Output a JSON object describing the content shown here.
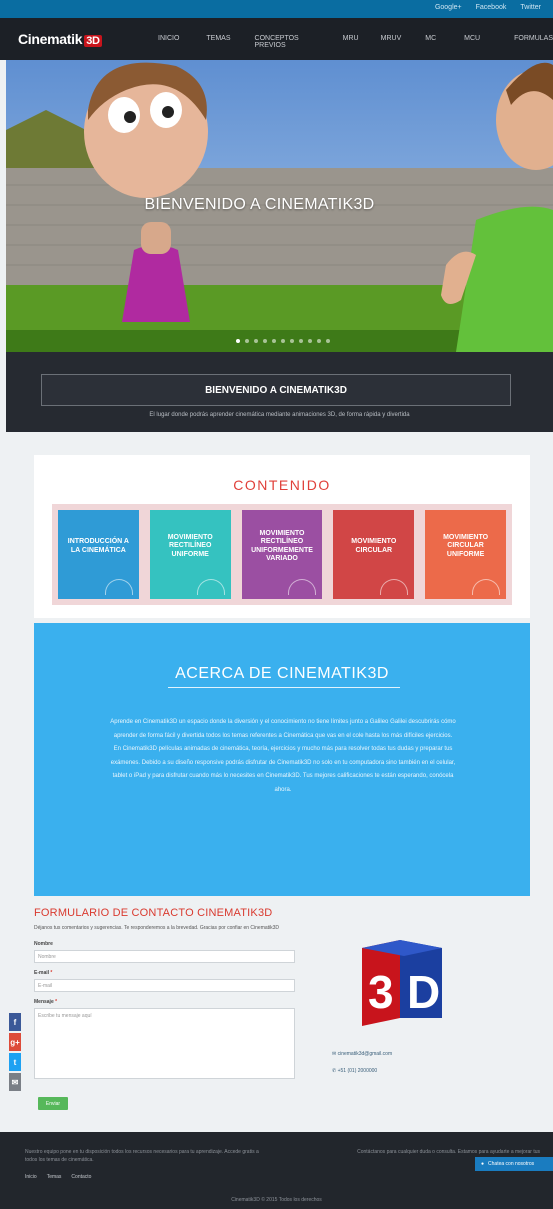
{
  "topbar": {
    "links": [
      "Google+",
      "Facebook",
      "Twitter"
    ]
  },
  "navbar": {
    "logo_text": "Cinematik",
    "logo_badge": "3D",
    "items": [
      "INICIO",
      "TEMAS",
      "CONCEPTOS PREVIOS",
      "MRU",
      "MRUV",
      "MC",
      "MCU",
      "FORMULAS"
    ]
  },
  "hero": {
    "title": "BIENVENIDO A CINEMATIK3D",
    "slide_count": 11,
    "active_slide": 1
  },
  "welcome": {
    "title": "BIENVENIDO A CINEMATIK3D",
    "subtitle": "El lugar donde podrás aprender cinemática mediante animaciones 3D, de forma rápida y divertida"
  },
  "contenido": {
    "title": "CONTENIDO",
    "cards": [
      {
        "label": "INTRODUCCIÓN A LA CINEMÁTICA",
        "color": "#2f9bd6"
      },
      {
        "label": "MOVIMIENTO RECTILÍNEO UNIFORME",
        "color": "#35c2c0"
      },
      {
        "label": "MOVIMIENTO RECTILÍNEO UNIFORMEMENTE VARIADO",
        "color": "#9b4fa2"
      },
      {
        "label": "MOVIMIENTO CIRCULAR",
        "color": "#d14646"
      },
      {
        "label": "MOVIMIENTO CIRCULAR UNIFORME",
        "color": "#ec6a4a"
      }
    ]
  },
  "acerca": {
    "title": "ACERCA DE CINEMATIK3D",
    "body": "Aprende en Cinematik3D un espacio donde la diversión y el conocimiento no tiene límites junto a Galileo Galilei descubrirás cómo aprender de forma fácil y divertida todos los temas referentes a Cinemática que vas en el cole hasta los más difíciles ejercicios. En Cinematik3D películas animadas de cinemática, teoría, ejercicios y mucho más para resolver todas tus dudas y preparar tus exámenes. Debido a su diseño responsive podrás disfrutar de Cinematik3D no solo en tu computadora sino también en el celular, tablet o iPad y para disfrutar cuando más lo necesites en Cinematik3D. Tus mejores calificaciones te están esperando, conócela ahora."
  },
  "form": {
    "title": "FORMULARIO DE CONTACTO CINEMATIK3D",
    "subtitle": "Déjanos tus comentarios y sugerencias. Te responderemos a la brevedad. Gracias por confiar en Cinematik3D",
    "name_label": "Nombre",
    "name_placeholder": "Nombre",
    "email_label": "E-mail",
    "email_placeholder": "E-mail",
    "message_label": "Mensaje",
    "message_placeholder": "Escribe tu mensaje aquí",
    "send_label": "Enviar",
    "email_contact": "cinematik3d@gmail.com",
    "phone_contact": "+51 (01) 2000000"
  },
  "footer": {
    "left_text": "Nuestro equipo pone en tu disposición todos los recursos necesarios para tu aprendizaje. Accede gratis a todos los temas de cinemática.",
    "right_text": "Contáctanos para cualquier duda o consulta. Estamos para ayudarte a mejorar tus calificaciones.",
    "links": [
      "Inicio",
      "Temas",
      "Contacto"
    ],
    "copyright": "Cinematik3D © 2015 Todos los derechos",
    "chat_label": "Chatea con nosotros"
  },
  "colors": {
    "accent": "#d93a2f",
    "primary": "#0a6da1",
    "about_bg": "#3ab0ee"
  }
}
